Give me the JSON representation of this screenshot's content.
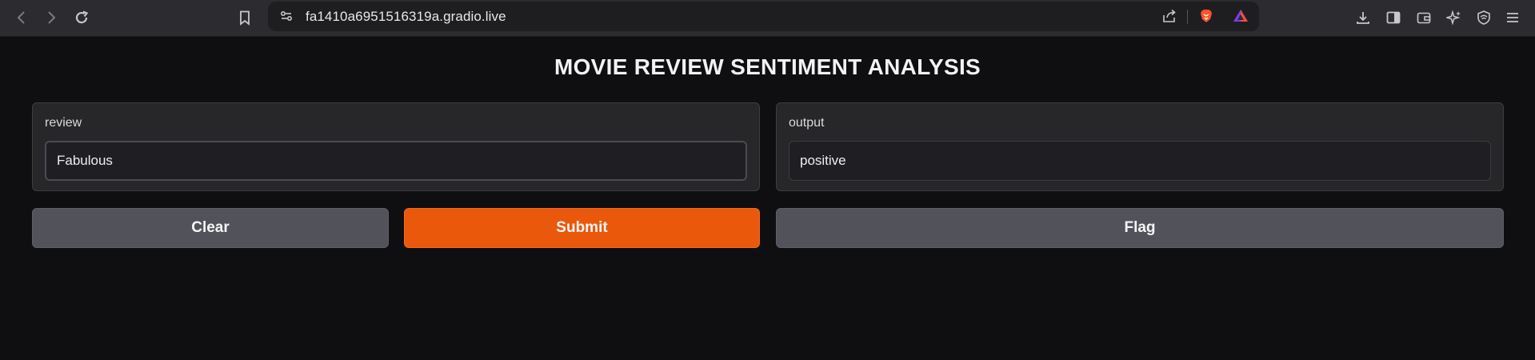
{
  "browser": {
    "url": "fa1410a6951516319a.gradio.live",
    "icons": {
      "back": "back-arrow-icon",
      "forward": "forward-arrow-icon",
      "reload": "reload-icon",
      "bookmark": "bookmark-icon",
      "site_settings": "site-settings-icon",
      "share": "share-icon",
      "brave_shields": "brave-lion-icon",
      "brave_rewards": "brave-rewards-triangle-icon",
      "downloads": "download-icon",
      "sidebar": "sidebar-icon",
      "wallet": "wallet-icon",
      "leo": "leo-ai-sparkle-icon",
      "vpn": "vpn-shield-icon",
      "menu": "hamburger-menu-icon"
    }
  },
  "app": {
    "title": "MOVIE REVIEW SENTIMENT ANALYSIS",
    "input": {
      "label": "review",
      "value": "Fabulous"
    },
    "output": {
      "label": "output",
      "value": "positive"
    },
    "buttons": {
      "clear": "Clear",
      "submit": "Submit",
      "flag": "Flag"
    },
    "colors": {
      "background": "#0f0f11",
      "panel": "#27272a",
      "primary": "#ea580c",
      "secondary": "#52535a"
    }
  }
}
